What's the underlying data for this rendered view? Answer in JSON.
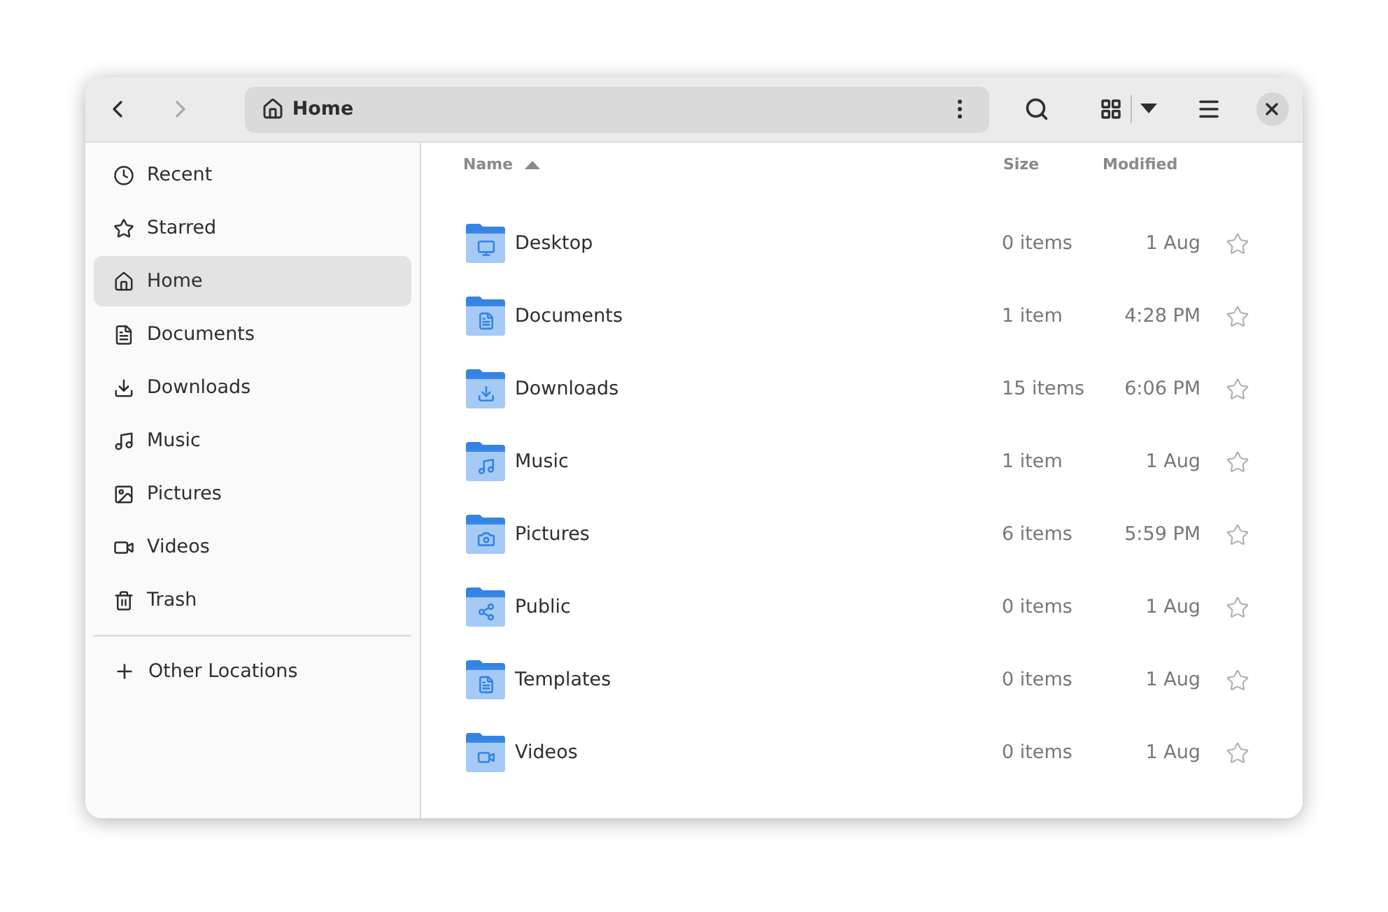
{
  "toolbar": {
    "back_disabled": false,
    "forward_disabled": true,
    "path": "Home"
  },
  "sidebar": {
    "items": [
      {
        "label": "Recent",
        "selected": false
      },
      {
        "label": "Starred",
        "selected": false
      },
      {
        "label": "Home",
        "selected": true
      },
      {
        "label": "Documents",
        "selected": false
      },
      {
        "label": "Downloads",
        "selected": false
      },
      {
        "label": "Music",
        "selected": false
      },
      {
        "label": "Pictures",
        "selected": false
      },
      {
        "label": "Videos",
        "selected": false
      },
      {
        "label": "Trash",
        "selected": false
      }
    ],
    "other": {
      "label": "Other Locations"
    }
  },
  "table": {
    "columns": [
      {
        "label": "Name",
        "sorted": true
      },
      {
        "label": "Size",
        "sorted": false
      },
      {
        "label": "Modified",
        "sorted": false
      }
    ],
    "rows": [
      {
        "name": "Desktop",
        "size": "0 items",
        "modified": "1 Aug",
        "starred": false
      },
      {
        "name": "Documents",
        "size": "1 item",
        "modified": "4:28 PM",
        "starred": false
      },
      {
        "name": "Downloads",
        "size": "15 items",
        "modified": "6:06 PM",
        "starred": false
      },
      {
        "name": "Music",
        "size": "1 item",
        "modified": "1 Aug",
        "starred": false
      },
      {
        "name": "Pictures",
        "size": "6 items",
        "modified": "5:59 PM",
        "starred": false
      },
      {
        "name": "Public",
        "size": "0 items",
        "modified": "1 Aug",
        "starred": false
      },
      {
        "name": "Templates",
        "size": "0 items",
        "modified": "1 Aug",
        "starred": false
      },
      {
        "name": "Videos",
        "size": "0 items",
        "modified": "1 Aug",
        "starred": false
      }
    ]
  }
}
